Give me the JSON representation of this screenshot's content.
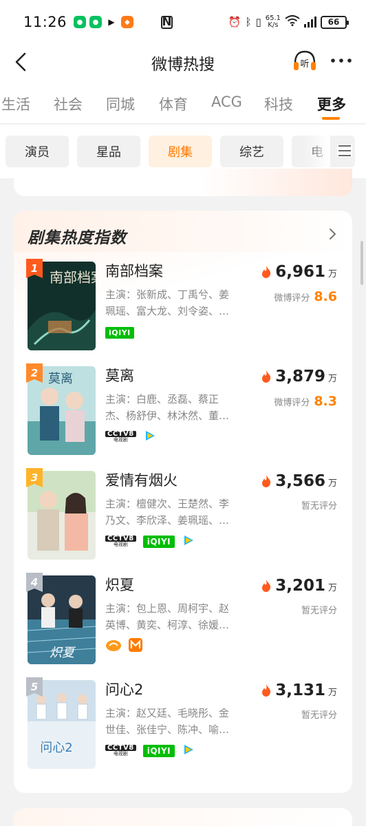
{
  "status_bar": {
    "time": "11:26",
    "network_speed": "65.1",
    "network_speed_unit": "K/s",
    "battery": "66"
  },
  "nav": {
    "title": "微博热搜"
  },
  "tabs": [
    "生活",
    "社会",
    "同城",
    "体育",
    "ACG",
    "科技",
    "更多"
  ],
  "active_tab": "更多",
  "chips": [
    "演员",
    "星品",
    "剧集",
    "综艺",
    "电"
  ],
  "active_chip": "剧集",
  "card": {
    "title": "剧集热度指数",
    "items": [
      {
        "rank": "1",
        "title": "南部档案",
        "cast_line1": "主演：张新成、丁禹兮、姜",
        "cast_line2": "珮瑶、富大龙、刘令姿、…",
        "heat": "6,961",
        "unit": "万",
        "score_label": "微博评分",
        "score": "8.6",
        "rank_color": "#ff5a1e",
        "poster_text": "南部档案"
      },
      {
        "rank": "2",
        "title": "莫离",
        "cast_line1": "主演：白鹿、丞磊、蔡正",
        "cast_line2": "杰、杨舒伊、林沐然、董…",
        "heat": "3,879",
        "unit": "万",
        "score_label": "微博评分",
        "score": "8.3",
        "rank_color": "#ff8a2a",
        "poster_text": "莫离"
      },
      {
        "rank": "3",
        "title": "爱情有烟火",
        "cast_line1": "主演：檀健次、王楚然、李",
        "cast_line2": "乃文、李欣泽、姜珮瑶、…",
        "heat": "3,566",
        "unit": "万",
        "score_label": "暂无评分",
        "score": "",
        "rank_color": "#ffb32a",
        "poster_text": ""
      },
      {
        "rank": "4",
        "title": "炽夏",
        "cast_line1": "主演：包上恩、周柯宇、赵",
        "cast_line2": "英博、黄奕、柯淳、徐媛…",
        "heat": "3,201",
        "unit": "万",
        "score_label": "暂无评分",
        "score": "",
        "rank_color": "#b9bec6",
        "poster_text": "炽夏"
      },
      {
        "rank": "5",
        "title": "问心2",
        "cast_line1": "主演：赵又廷、毛晓彤、金",
        "cast_line2": "世佳、张佳宁、陈冲、喻…",
        "heat": "3,131",
        "unit": "万",
        "score_label": "暂无评分",
        "score": "",
        "rank_color": "#b9bec6",
        "poster_text": "问心2"
      }
    ]
  },
  "logos": {
    "iqiyi": "iQIYI",
    "cctv": "CCTV8",
    "cctv_sub": "电视剧"
  },
  "colors": {
    "accent": "#ff8200",
    "flame": "#ff5a1e"
  }
}
